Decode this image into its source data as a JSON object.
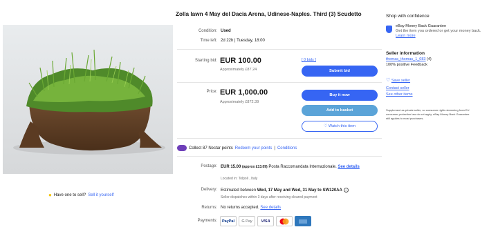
{
  "listing": {
    "title": "Zolla lawn 4 May del Dacia Arena, Udinese-Naples. Third (3) Scudetto",
    "condition_label": "Condition:",
    "condition_value": "Used",
    "time_left_label": "Time left:",
    "time_left_value": "2d 22h | Tuesday, 18:00"
  },
  "bid": {
    "label": "Starting bid:",
    "price": "EUR 100.00",
    "approx": "Approximately £87.24",
    "bids_link": "[ 0 bids ]",
    "submit_label": "Submit bid"
  },
  "buy": {
    "label": "Price:",
    "price": "EUR 1,000.00",
    "approx": "Approximately £872.39",
    "buy_now_label": "Buy it now",
    "add_basket_label": "Add to basket",
    "watch_label": "♡ Watch this item"
  },
  "nectar": {
    "text": "Collect 87 Nectar points",
    "redeem_link": "Redeem your points",
    "separator": "|",
    "conditions_link": "Conditions"
  },
  "postage": {
    "label": "Postage:",
    "price": "EUR 15.00",
    "approx": "(approx £13.09)",
    "method": "Posta Raccomandata Internazionale.",
    "details_link": "See details",
    "location": "Located in: Tolpoli , Italy"
  },
  "delivery": {
    "label": "Delivery:",
    "text_prefix": "Estimated between",
    "date_range": "Wed, 17 May and Wed, 31 May to SW120AA",
    "note": "Seller dispatches within 3 days after receiving cleared payment"
  },
  "returns": {
    "label": "Returns:",
    "text": "No returns accepted.",
    "details_link": "See details"
  },
  "payments": {
    "label": "Payments:",
    "methods": [
      "PayPal",
      "G Pay",
      "VISA",
      "Mastercard",
      "AmEx"
    ]
  },
  "left": {
    "have_one_text": "Have one to sell?",
    "sell_link": "Sell it yourself"
  },
  "sidebar": {
    "shop_title": "Shop with confidence",
    "guarantee_title": "eBay Money Back Guarantee",
    "guarantee_sub": "Get the item you ordered or get your money back.",
    "learn_more": "Learn more",
    "seller_title": "Seller information",
    "seller_name": "thomas_thomas_1_083",
    "seller_score": "(4)",
    "feedback": "100% positive Feedback",
    "save_seller": "Save seller",
    "contact_seller": "Contact seller",
    "see_other": "See other items",
    "legal": "Supplement as private seller, so consumer rights stemming from EU consumer protection law do not apply. eBay Money Back Guarantee still applies to most purchases."
  },
  "colors": {
    "primary_blue": "#3665f3",
    "secondary_blue": "#5ba4d8",
    "nectar_purple": "#6e3fb9"
  }
}
